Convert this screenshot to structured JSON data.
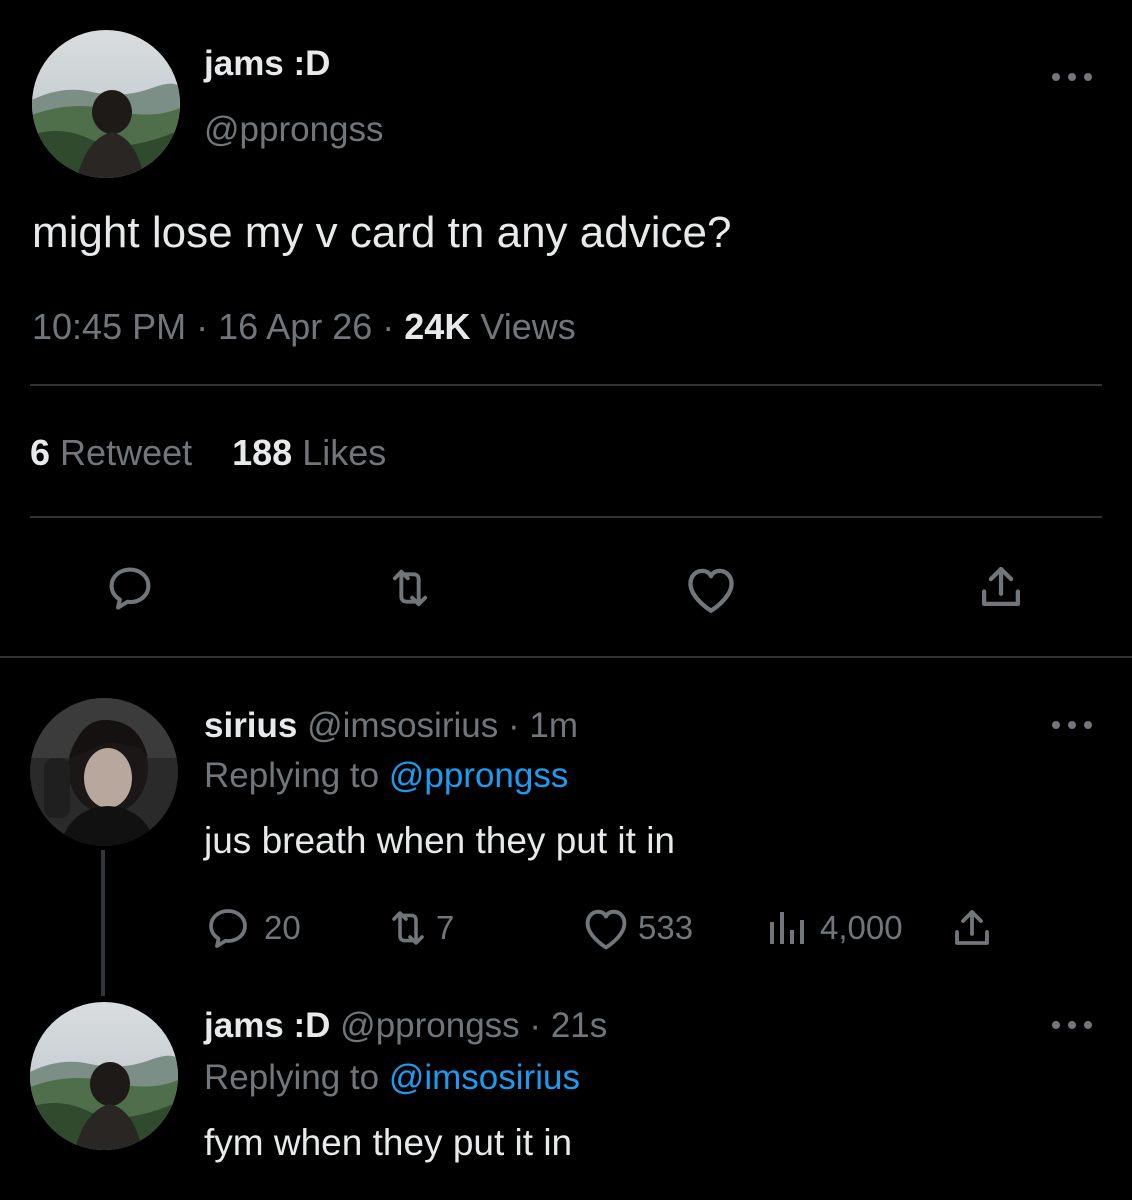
{
  "main_tweet": {
    "display_name": "jams :D",
    "handle": "@pprongss",
    "text": "might lose my v card tn any advice?",
    "time": "10:45 PM",
    "date": "16 Apr 26",
    "views_count": "24K",
    "views_label": "Views",
    "retweet_count": "6",
    "retweet_label": "Retweet",
    "likes_count": "188",
    "likes_label": "Likes"
  },
  "reply_1": {
    "display_name": "sirius",
    "handle": "@imsosirius",
    "time": "1m",
    "replying_label": "Replying to",
    "replying_to": "@pprongss",
    "text": "jus breath when they put it in",
    "reply_count": "20",
    "retweet_count": "7",
    "like_count": "533",
    "view_count": "4,000"
  },
  "reply_2": {
    "display_name": "jams :D",
    "handle": "@pprongss",
    "time": "21s",
    "replying_label": "Replying to",
    "replying_to": "@imsosirius",
    "text": "fym when they put it in"
  },
  "separator": "·",
  "colors": {
    "background": "#000000",
    "text": "#e7e9ea",
    "muted": "#71767b",
    "link": "#1d9bf0",
    "divider": "#2f3336"
  },
  "icons": [
    "more-icon",
    "reply-icon",
    "retweet-icon",
    "like-icon",
    "share-icon",
    "views-icon"
  ]
}
